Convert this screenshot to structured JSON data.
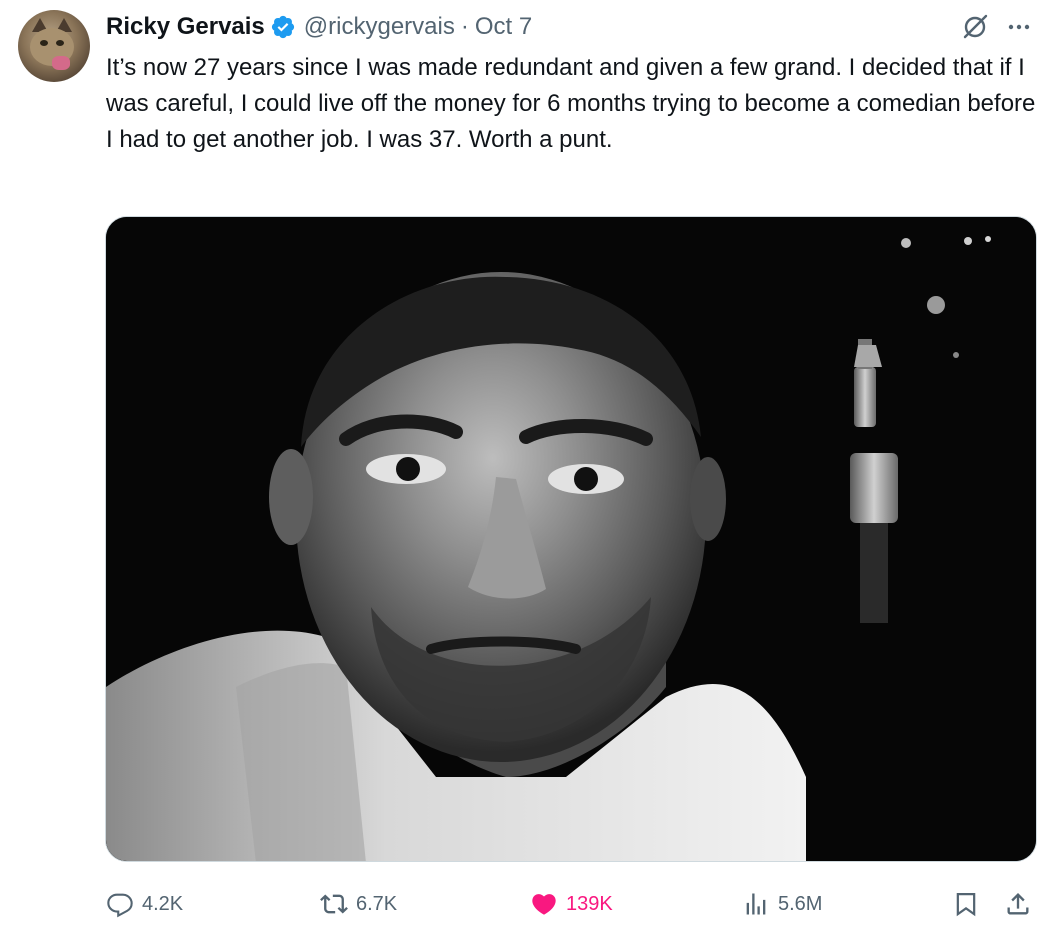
{
  "author": {
    "display_name": "Ricky Gervais",
    "handle": "@rickygervais",
    "separator": "·",
    "date": "Oct 7"
  },
  "tweet": {
    "text": "It’s now 27 years since I was made redundant and given a few grand. I decided that if I was careful, I could live off the money for 6 months trying to become a comedian before I had to get another job. I was 37. Worth a punt."
  },
  "icons": {
    "verified": "verified-badge-icon",
    "grok": "grok-icon",
    "more": "more-icon",
    "reply": "reply-icon",
    "retweet": "retweet-icon",
    "like": "heart-icon",
    "views": "views-icon",
    "bookmark": "bookmark-icon",
    "share": "share-icon"
  },
  "actions": {
    "replies": "4.2K",
    "retweets": "6.7K",
    "likes": "139K",
    "views": "5.6M"
  },
  "colors": {
    "text": "#0f1419",
    "secondary": "#536471",
    "verified": "#1d9bf0",
    "like": "#f91880"
  }
}
